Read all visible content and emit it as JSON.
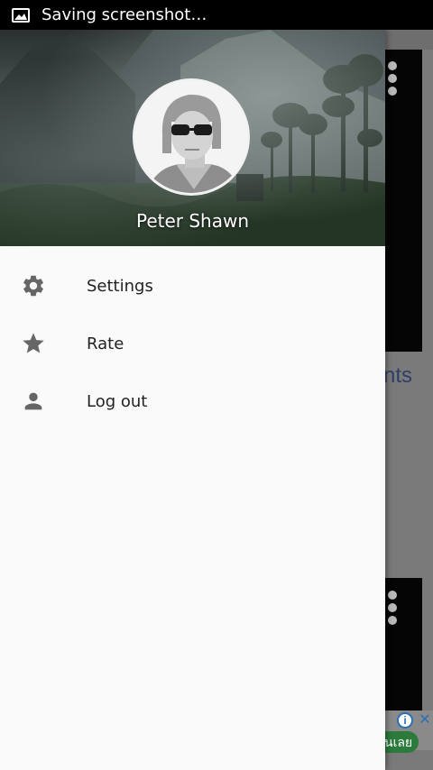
{
  "status_bar": {
    "text": "Saving screenshot…",
    "icon": "image-icon"
  },
  "background_app": {
    "partial_heading": "nts",
    "ad": {
      "info_icon": "info-icon",
      "close_icon": "close-icon",
      "button_text": "นเลย"
    }
  },
  "drawer": {
    "user_name": "Peter Shawn",
    "menu": [
      {
        "label": "Settings",
        "icon": "gear-icon"
      },
      {
        "label": "Rate",
        "icon": "star-icon"
      },
      {
        "label": "Log out",
        "icon": "person-icon"
      }
    ]
  },
  "colors": {
    "drawer_bg": "#fafafa",
    "icon_gray": "#666666",
    "status_bar_bg": "#000000"
  }
}
